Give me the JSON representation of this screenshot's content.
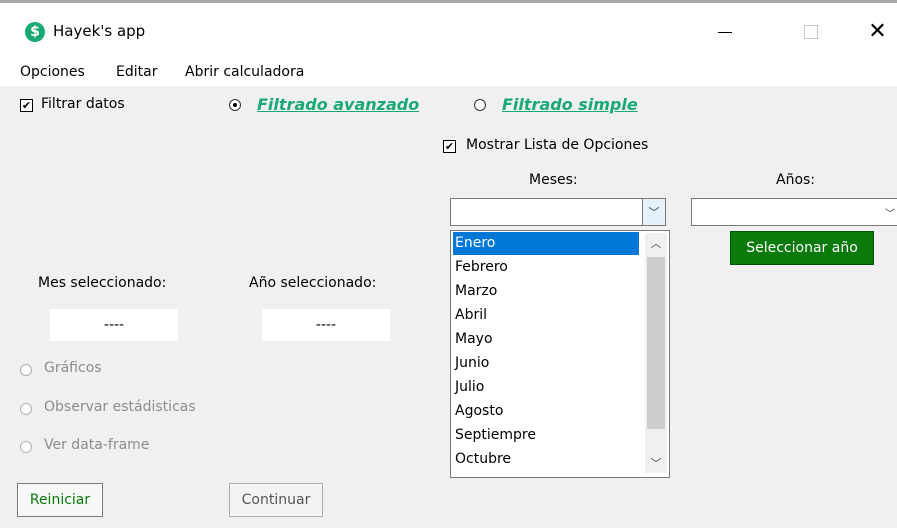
{
  "window": {
    "title": "Hayek's app",
    "icon_glyph": "$",
    "close_glyph": "✕"
  },
  "menu": [
    "Opciones",
    "Editar",
    "Abrir calculadora"
  ],
  "filtrar": {
    "label": "Filtrar datos",
    "checked": true
  },
  "radios": {
    "avanzado": {
      "label": "Filtrado avanzado",
      "selected": true
    },
    "simple": {
      "label": "Filtrado simple",
      "selected": false
    }
  },
  "mostrar_lista": {
    "label": "Mostrar Lista de Opciones",
    "checked": true
  },
  "meses": {
    "label": "Meses:",
    "value": "",
    "items": [
      "Enero",
      "Febrero",
      "Marzo",
      "Abril",
      "Mayo",
      "Junio",
      "Julio",
      "Agosto",
      "Septiempre",
      "Octubre"
    ],
    "selected_index": 0
  },
  "anios": {
    "label": "Años:",
    "value": ""
  },
  "seleccionar_anio": "Seleccionar año",
  "mes_seleccionado": {
    "label": "Mes seleccionado:",
    "value": "----"
  },
  "anio_seleccionado": {
    "label": "Año seleccionado:",
    "value": "----"
  },
  "opciones_radio": [
    "Gráficos",
    "Observar estádisticas",
    "Ver data-frame"
  ],
  "buttons": {
    "reiniciar": "Reiniciar",
    "continuar": "Continuar"
  },
  "colors": {
    "accent_green": "#19a974",
    "button_green": "#0a7a0a",
    "selection_blue": "#0078d7"
  }
}
